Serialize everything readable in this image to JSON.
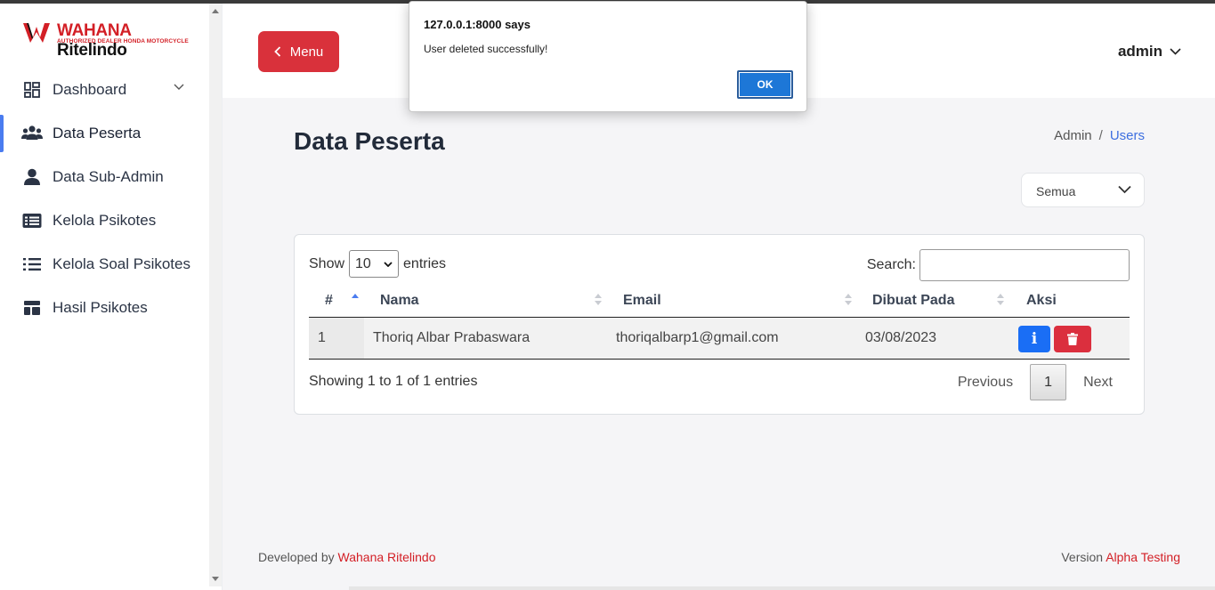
{
  "brand": {
    "name_prefix": "WAHANA",
    "name_suffix": " Ritelindo",
    "tagline": "AUTHORIZED DEALER HONDA MOTORCYCLE",
    "colors": {
      "red": "#d31f26",
      "accent_blue": "#4a7cf0"
    }
  },
  "sidebar": {
    "items": [
      {
        "label": "Dashboard",
        "icon": "dashboard-grid-icon",
        "has_chevron": true
      },
      {
        "label": "Data Peserta",
        "icon": "users-icon",
        "active": true
      },
      {
        "label": "Data Sub-Admin",
        "icon": "user-icon"
      },
      {
        "label": "Kelola Psikotes",
        "icon": "list-card-icon"
      },
      {
        "label": "Kelola Soal Psikotes",
        "icon": "list-icon"
      },
      {
        "label": "Hasil Psikotes",
        "icon": "layout-icon"
      }
    ]
  },
  "header": {
    "menu_label": "Menu",
    "user_label": "admin"
  },
  "page": {
    "title": "Data Peserta",
    "breadcrumb": {
      "root": "Admin",
      "separator": "/",
      "current": "Users"
    },
    "filter_value": "Semua"
  },
  "table": {
    "show_label": "Show",
    "entries_value": "10",
    "entries_label": "entries",
    "search_label": "Search:",
    "columns": [
      "#",
      "Nama",
      "Email",
      "Dibuat Pada",
      "Aksi"
    ],
    "rows": [
      {
        "no": "1",
        "nama": "Thoriq Albar Prabaswara",
        "email": "thoriqalbarp1@gmail.com",
        "dibuat": "03/08/2023"
      }
    ],
    "info_text": "Showing 1 to 1 of 1 entries",
    "pagination": {
      "previous": "Previous",
      "current": "1",
      "next": "Next"
    },
    "info_button_glyph": "i"
  },
  "footer": {
    "left_prefix": "Developed by ",
    "left_link": "Wahana Ritelindo",
    "right_prefix": "Version ",
    "right_link": "Alpha Testing"
  },
  "dialog": {
    "title": "127.0.0.1:8000 says",
    "message": "User deleted successfully!",
    "ok_label": "OK"
  }
}
